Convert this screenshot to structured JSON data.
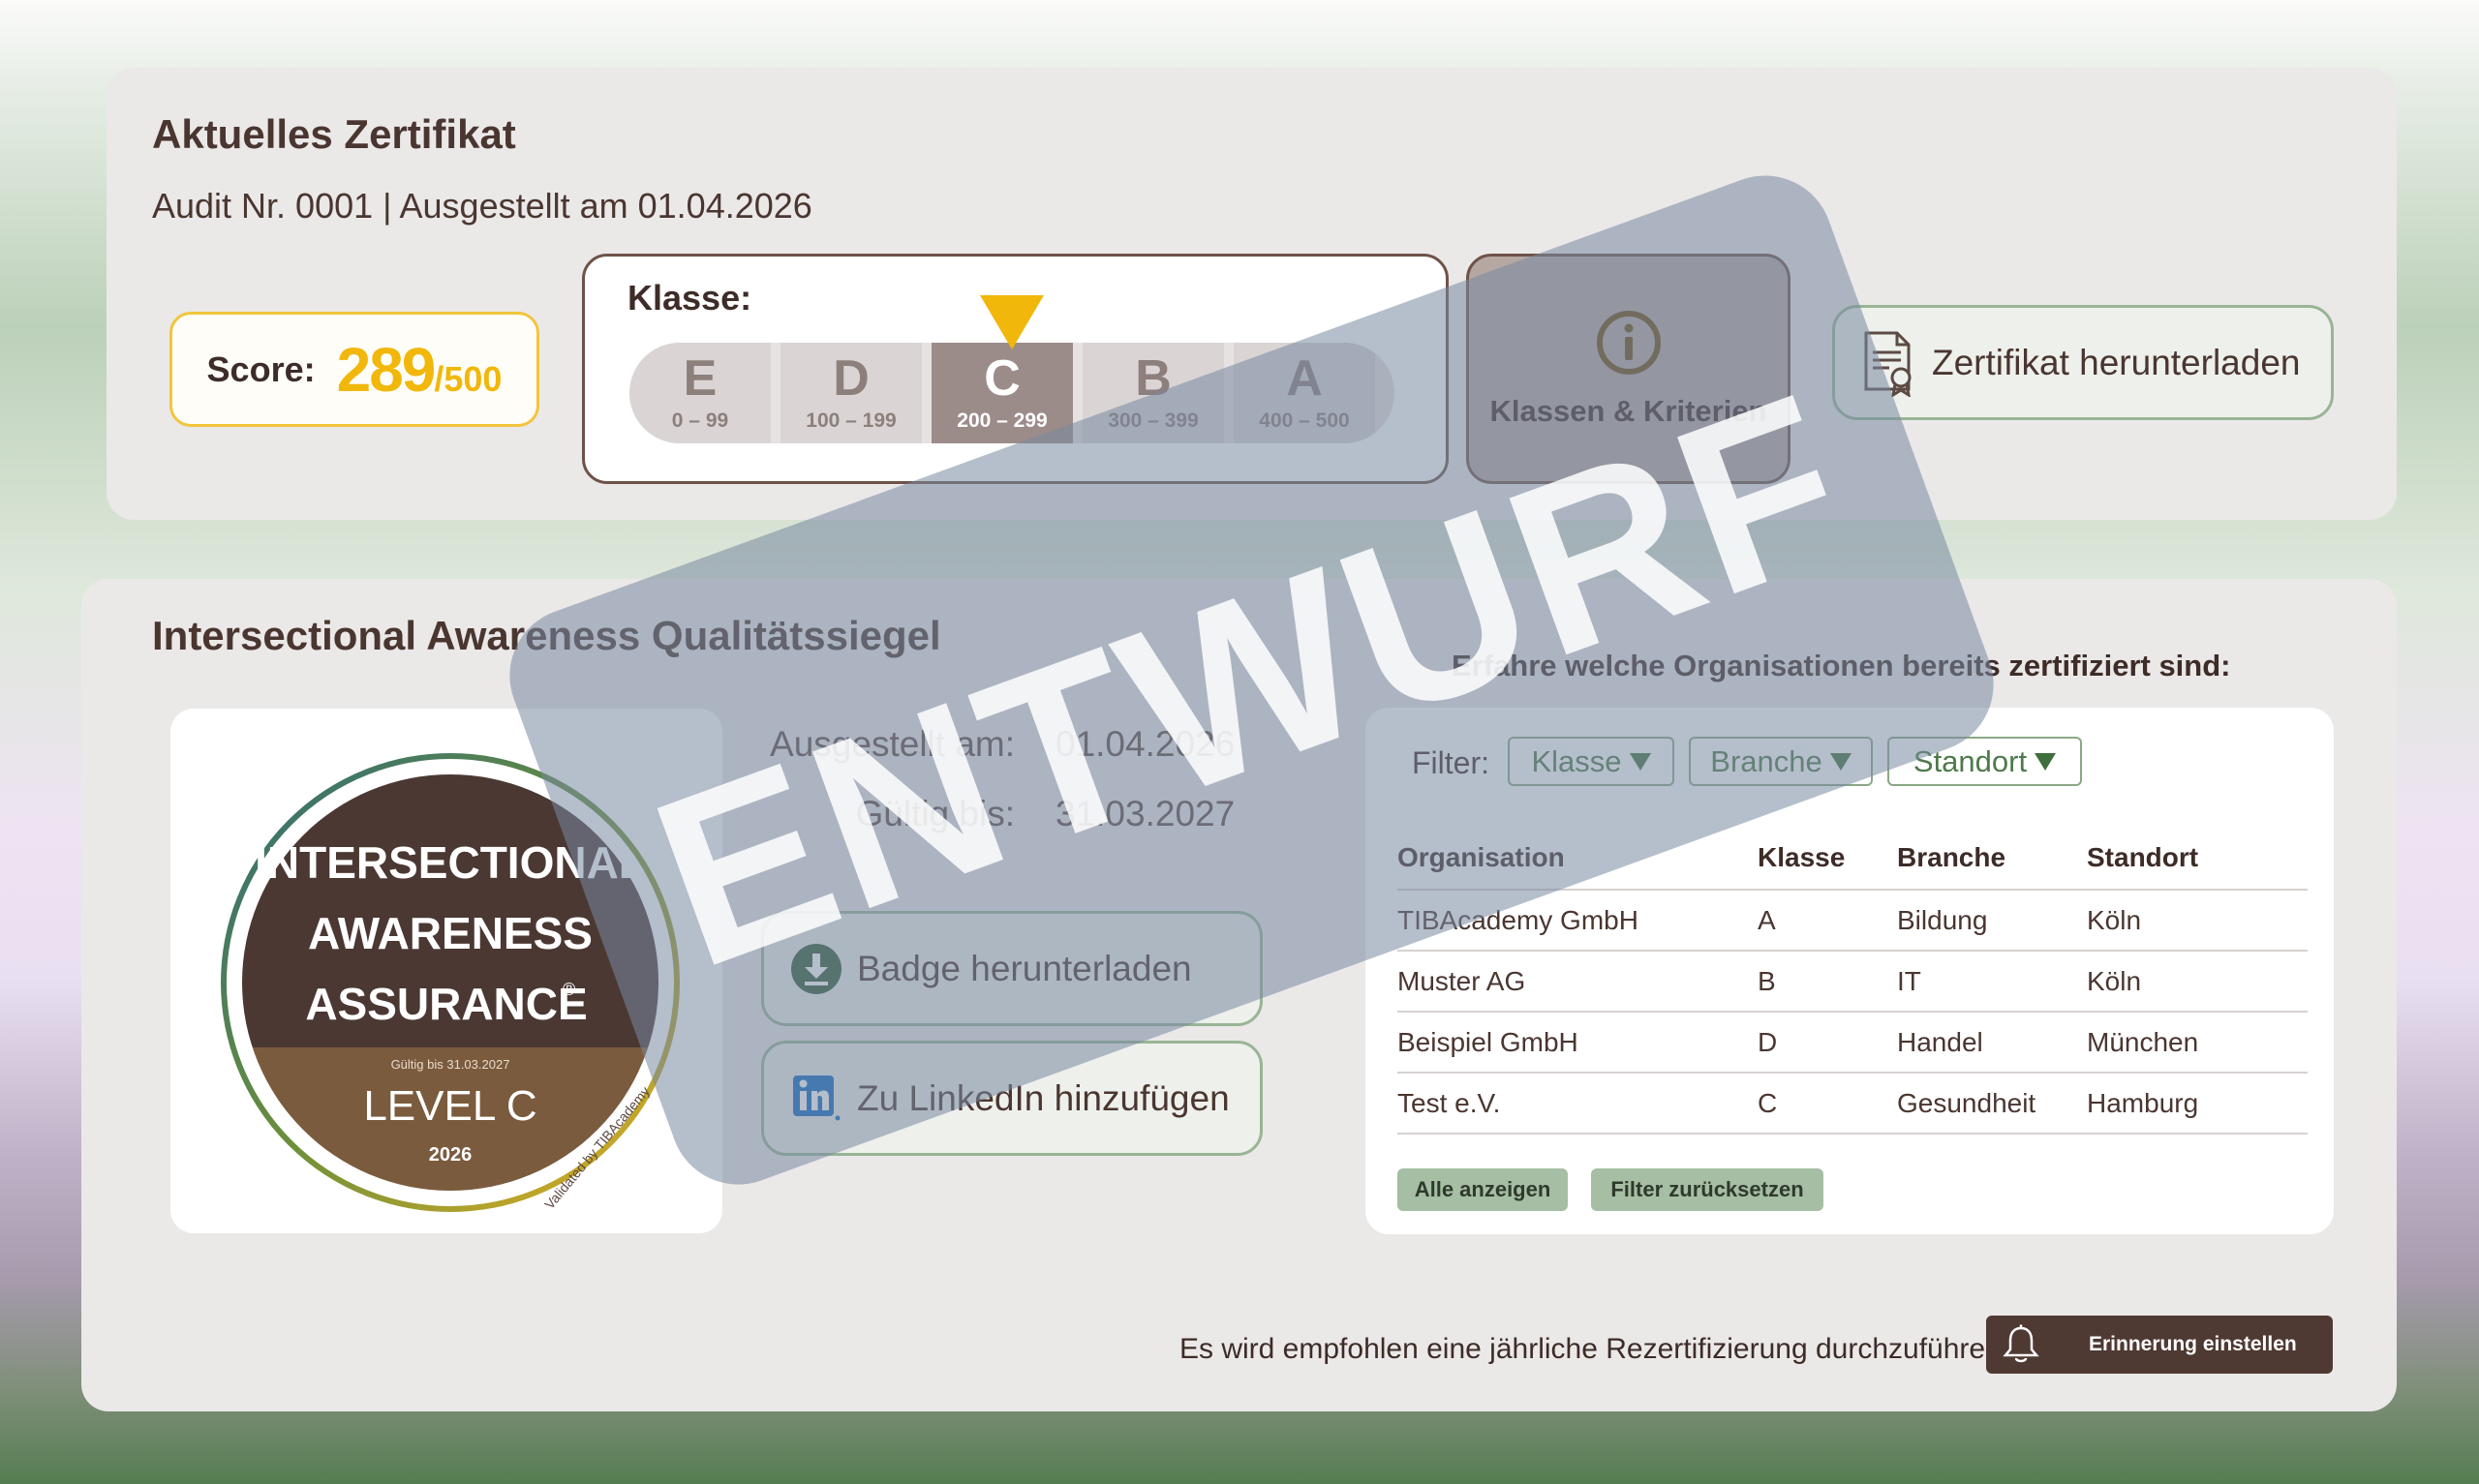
{
  "certificate": {
    "title": "Aktuelles Zertifikat",
    "audit": "Audit Nr. 0001 |  Ausgestellt am 01.04.2026",
    "score_label": "Score:",
    "score_value": "289",
    "score_max": "/500",
    "class_label": "Klasse:",
    "current_class": "C",
    "classes": [
      {
        "letter": "E",
        "range": "0 – 99"
      },
      {
        "letter": "D",
        "range": "100 – 199"
      },
      {
        "letter": "C",
        "range": "200 – 299"
      },
      {
        "letter": "B",
        "range": "300 – 399"
      },
      {
        "letter": "A",
        "range": "400 – 500"
      }
    ],
    "criteria_label": "Klassen & Kriterien",
    "download_label": "Zertifikat herunterladen"
  },
  "seal": {
    "title": "Intersectional Awareness Qualitätssiegel",
    "badge": {
      "line1": "INTERSECTIONAL",
      "line2": "AWARENESS",
      "line3": "ASSURANCE",
      "registered": "®",
      "valid_small": "Gültig bis 31.03.2027",
      "level": "LEVEL C",
      "year": "2026",
      "validated_by": "Validated by TIBAcademy"
    },
    "issued_label": "Ausgestellt am:",
    "issued_value": "01.04.2026",
    "valid_label": "Gültig bis:",
    "valid_value": "31.03.2027",
    "badge_download": "Badge herunterladen",
    "linkedin": "Zu LinkedIn hinzufügen"
  },
  "organizations": {
    "heading": "Erfahre welche Organisationen bereits zertifiziert sind:",
    "filter_label": "Filter:",
    "filters": [
      "Klasse",
      "Branche",
      "Standort"
    ],
    "columns": [
      "Organisation",
      "Klasse",
      "Branche",
      "Standort"
    ],
    "rows": [
      [
        "TIBAcademy GmbH",
        "A",
        "Bildung",
        "Köln"
      ],
      [
        "Muster AG",
        "B",
        "IT",
        "Köln"
      ],
      [
        "Beispiel GmbH",
        "D",
        "Handel",
        "München"
      ],
      [
        "Test e.V.",
        "C",
        "Gesundheit",
        "Hamburg"
      ]
    ],
    "show_all": "Alle anzeigen",
    "reset_filter": "Filter zurücksetzen"
  },
  "footer": {
    "recert_text": "Es wird empfohlen eine jährliche Rezertifizierung durchzuführen!",
    "reminder_label": "Erinnerung einstellen"
  },
  "watermark": "ENTWURF",
  "colors": {
    "accent_yellow": "#f1b70b",
    "brown_dark": "#4f3933",
    "green_border": "#98b594"
  },
  "icons": {
    "criteria": "info-icon",
    "download_cert": "certificate-icon",
    "badge_download": "download-icon",
    "linkedin": "linkedin-icon",
    "reminder": "bell-icon"
  }
}
